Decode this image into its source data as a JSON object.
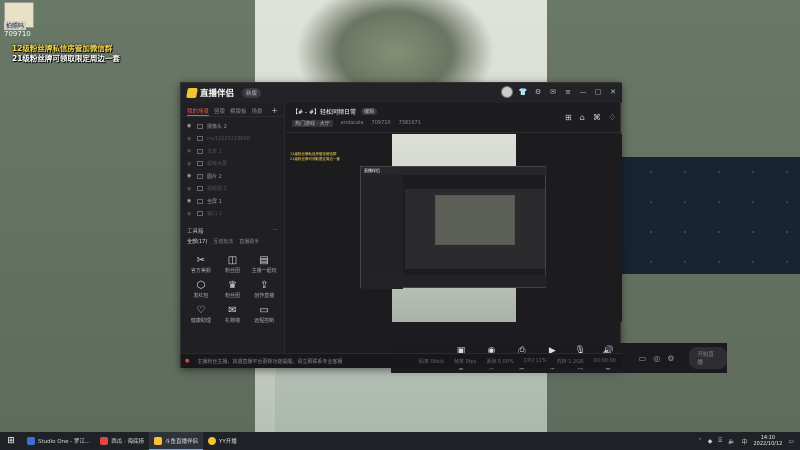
{
  "overlay": {
    "watermark_label": "拍照吗",
    "room_id": "709710",
    "promo_line1": "12级粉丝牌私信房管加微信群",
    "promo_line2": "21级粉丝牌可领取限定周边一套"
  },
  "app": {
    "name": "直播伴侣",
    "version_badge": "新版",
    "titlebar_icons": [
      "avatar",
      "shirt-icon",
      "settings-icon",
      "mail-icon",
      "menu-icon",
      "minimize-icon",
      "maximize-icon",
      "close-icon"
    ]
  },
  "sidebar": {
    "tabs": [
      "我的场景",
      "竖版",
      "横版板",
      "场景"
    ],
    "active_tab": 0,
    "add_label": "+",
    "sources": [
      {
        "label": "摄像头 2",
        "visible": true
      },
      {
        "label": "my1212021960ft",
        "visible": false
      },
      {
        "label": "文本 1",
        "visible": false
      },
      {
        "label": "超级大屏",
        "visible": false
      },
      {
        "label": "图片 2",
        "visible": true
      },
      {
        "label": "视频源 1",
        "visible": false
      },
      {
        "label": "全屏 1",
        "visible": true
      },
      {
        "label": "窗口 1",
        "visible": false
      }
    ],
    "toolbox_title": "工具箱",
    "tool_tabs": [
      "全部(17)",
      "互动玩法",
      "直播助手"
    ],
    "tools": [
      {
        "icon": "✂",
        "label": "官方美颜"
      },
      {
        "icon": "◫",
        "label": "粉丝团"
      },
      {
        "icon": "▤",
        "label": "主播一起玩"
      },
      {
        "icon": "⬡",
        "label": "发红包"
      },
      {
        "icon": "♛",
        "label": "粉丝团"
      },
      {
        "icon": "⇪",
        "label": "创作直播"
      },
      {
        "icon": "♡",
        "label": "健康助理"
      },
      {
        "icon": "✉",
        "label": "礼物墙"
      },
      {
        "icon": "▭",
        "label": "远程控制"
      }
    ]
  },
  "room": {
    "title": "【# - #】轻松同频日常",
    "edit_badge": "编辑",
    "category": "热门游戏 · 大厅",
    "streamer": "endacala",
    "room_no": "709710",
    "fans": "7381671"
  },
  "preview": {
    "nested_title": "直播伴侣"
  },
  "bottom_tools": [
    {
      "icon": "▣",
      "label": "直播画面"
    },
    {
      "icon": "◉",
      "label": "摄像头"
    },
    {
      "icon": "⎙",
      "label": "手机投屏"
    },
    {
      "icon": "▶",
      "label": "多媒体"
    },
    {
      "icon": "🎙",
      "label": "麦克风"
    },
    {
      "icon": "🔊",
      "label": "扬声器"
    }
  ],
  "go_live_label": "开始直播",
  "status": {
    "warning": "主播粉丝主播，如遇直播平台更新功能提醒，请立即联系专业客服",
    "stats": [
      "码率 0kb/s",
      "帧率 0fps",
      "丢帧 0.00%",
      "CPU 11%",
      "内存 1.2GB",
      "00:00:00"
    ]
  },
  "taskbar": {
    "tasks": [
      {
        "label": "Studio One - 罗江...",
        "color": "#3b6fd4",
        "active": false
      },
      {
        "label": "西瓜 · 海底捞",
        "color": "#e04646",
        "active": false
      },
      {
        "label": "斗鱼直播伴侣",
        "color": "#f5c431",
        "active": true
      },
      {
        "label": "YY开播",
        "color": "#f5c431",
        "active": false
      }
    ],
    "time": "14:10",
    "date": "2022/10/12"
  }
}
